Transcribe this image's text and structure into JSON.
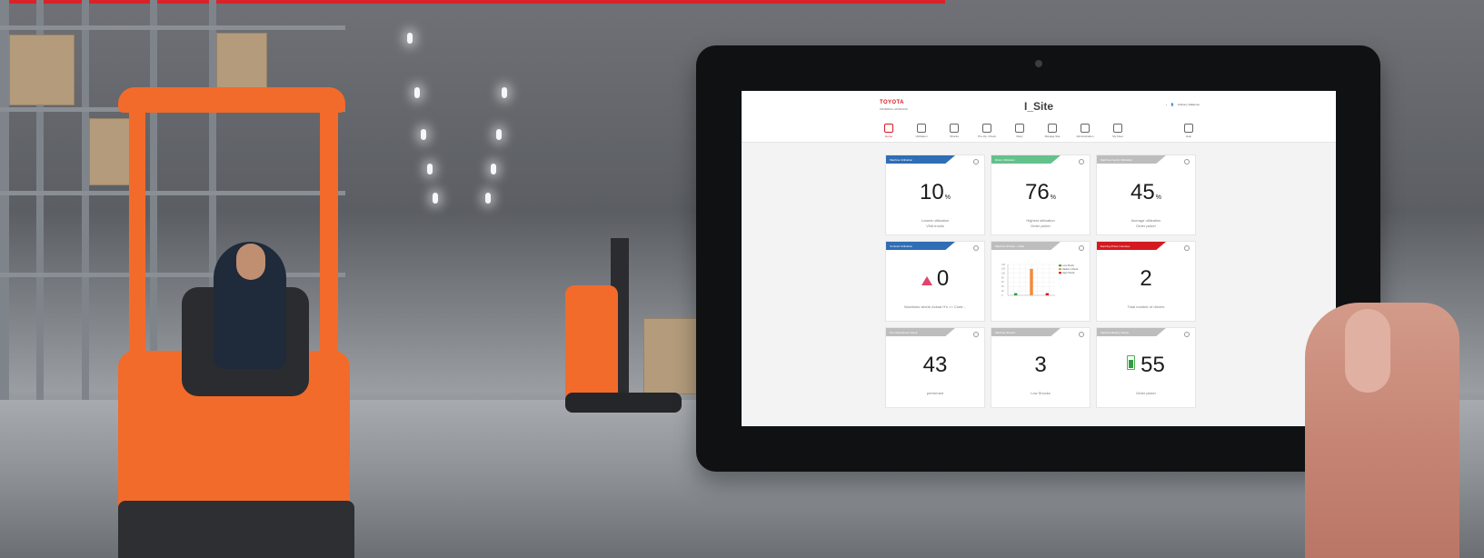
{
  "tablet": {
    "app": {
      "brand": {
        "name": "TOYOTA",
        "subtitle": "MATERIAL HANDLING"
      },
      "title": "I_Site",
      "user": {
        "name": "Anthony Valtaumo"
      },
      "nav": {
        "items": [
          {
            "label": "Home",
            "icon": "home-icon",
            "active": true
          },
          {
            "label": "Utilization",
            "icon": "utilization-icon"
          },
          {
            "label": "Shocks",
            "icon": "shocks-icon"
          },
          {
            "label": "Pre-Op. Check",
            "icon": "checklist-icon"
          },
          {
            "label": "Diary",
            "icon": "diary-icon"
          },
          {
            "label": "Manage Site",
            "icon": "manage-site-icon"
          },
          {
            "label": "Administration",
            "icon": "administration-icon"
          },
          {
            "label": "My Fleet",
            "icon": "fleet-icon"
          }
        ],
        "help_label": "Help"
      }
    },
    "cards": [
      {
        "title": "Machine Utilization",
        "value": "10",
        "unit": "%",
        "line1": "Lowest utilization",
        "line2": "VNA trucks",
        "header_color": "#2f6db5"
      },
      {
        "title": "Driver Utilization",
        "value": "76",
        "unit": "%",
        "line1": "Highest utilization",
        "line2": "Order picker",
        "header_color": "#63c18b"
      },
      {
        "title": "Machine Family Utilization",
        "value": "45",
        "unit": "%",
        "line1": "Average utilization",
        "line2": "Order picker",
        "header_color": "#bdbdbd"
      },
      {
        "title": "Contract Utilization",
        "value": "0",
        "line1": "Machines where Actual H's >> Contr...",
        "header_color": "#2f6db5"
      },
      {
        "title": "Machine Shocks - Chart",
        "header_color": "#bdbdbd"
      },
      {
        "title": "Expiring Driver Licenses",
        "value": "2",
        "line1": "Total number of drivers",
        "header_color": "#d41920"
      },
      {
        "title": "Pre Operational Check",
        "value": "43",
        "line1": "performed",
        "header_color": "#bdbdbd"
      },
      {
        "title": "Machine Shocks",
        "value": "3",
        "line1": "Low Shocks",
        "header_color": "#bdbdbd"
      },
      {
        "title": "Machine Battery Status",
        "value": "55",
        "line1": "Order picker",
        "header_color": "#bdbdbd"
      }
    ]
  },
  "chart_data": {
    "type": "bar",
    "categories": [
      "",
      "",
      ""
    ],
    "series": [
      {
        "name": "Low Shock",
        "color": "#2e9e41",
        "values": [
          10,
          0,
          0
        ]
      },
      {
        "name": "Medium Shock",
        "color": "#f28b3c",
        "values": [
          0,
          120,
          0
        ]
      },
      {
        "name": "High Shock",
        "color": "#d41920",
        "values": [
          0,
          0,
          10
        ]
      }
    ],
    "ylim": [
      0,
      140
    ],
    "yticks": [
      "140",
      "120",
      "100",
      "80",
      "60",
      "40",
      "20",
      "0"
    ],
    "legend_position": "right"
  }
}
